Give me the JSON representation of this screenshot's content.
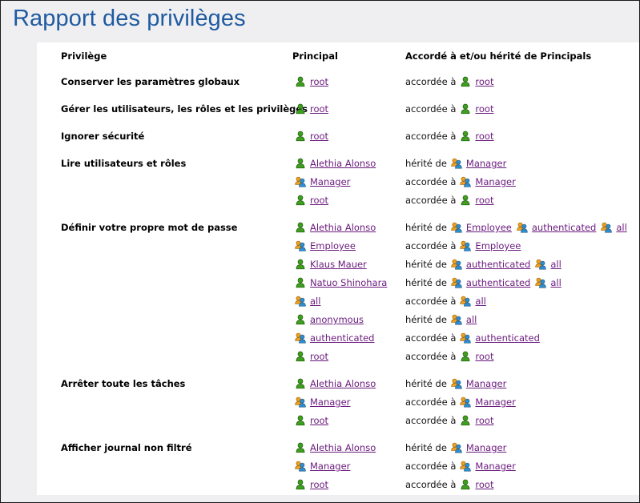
{
  "page": {
    "title": "Rapport des privilèges"
  },
  "colors": {
    "title": "#1f5aa0",
    "link": "#6a1b7d",
    "user_icon": "#3ea01e",
    "group_icon_front": "#2e8fd0",
    "group_icon_back": "#f0a020"
  },
  "table": {
    "headers": [
      "Privilège",
      "Principal",
      "Accordé à et/ou hérité de Principals"
    ],
    "rows": [
      {
        "privilege": "Conserver les paramètres globaux",
        "entries": [
          {
            "principal": {
              "name": "root",
              "icon": "user-icon"
            },
            "verb": "accordée à",
            "sources": [
              {
                "name": "root",
                "icon": "user-icon"
              }
            ]
          }
        ]
      },
      {
        "privilege": "Gérer les utilisateurs, les rôles et les privilèges",
        "entries": [
          {
            "principal": {
              "name": "root",
              "icon": "user-icon"
            },
            "verb": "accordée à",
            "sources": [
              {
                "name": "root",
                "icon": "user-icon"
              }
            ]
          }
        ]
      },
      {
        "privilege": "Ignorer sécurité",
        "entries": [
          {
            "principal": {
              "name": "root",
              "icon": "user-icon"
            },
            "verb": "accordée à",
            "sources": [
              {
                "name": "root",
                "icon": "user-icon"
              }
            ]
          }
        ]
      },
      {
        "privilege": "Lire utilisateurs et rôles",
        "entries": [
          {
            "principal": {
              "name": "Alethia Alonso",
              "icon": "user-icon"
            },
            "verb": "hérité de",
            "sources": [
              {
                "name": "Manager",
                "icon": "group-icon"
              }
            ]
          },
          {
            "principal": {
              "name": "Manager",
              "icon": "group-icon"
            },
            "verb": "accordée à",
            "sources": [
              {
                "name": "Manager",
                "icon": "group-icon"
              }
            ]
          },
          {
            "principal": {
              "name": "root",
              "icon": "user-icon"
            },
            "verb": "accordée à",
            "sources": [
              {
                "name": "root",
                "icon": "user-icon"
              }
            ]
          }
        ]
      },
      {
        "privilege": "Définir votre propre mot de passe",
        "entries": [
          {
            "principal": {
              "name": "Alethia Alonso",
              "icon": "user-icon"
            },
            "verb": "hérité de",
            "sources": [
              {
                "name": "Employee",
                "icon": "group-icon"
              },
              {
                "name": "authenticated",
                "icon": "group-icon"
              },
              {
                "name": "all",
                "icon": "group-icon"
              }
            ]
          },
          {
            "principal": {
              "name": "Employee",
              "icon": "group-icon"
            },
            "verb": "accordée à",
            "sources": [
              {
                "name": "Employee",
                "icon": "group-icon"
              }
            ]
          },
          {
            "principal": {
              "name": "Klaus Mauer",
              "icon": "user-icon"
            },
            "verb": "hérité de",
            "sources": [
              {
                "name": "authenticated",
                "icon": "group-icon"
              },
              {
                "name": "all",
                "icon": "group-icon"
              }
            ]
          },
          {
            "principal": {
              "name": "Natuo Shinohara",
              "icon": "user-icon"
            },
            "verb": "hérité de",
            "sources": [
              {
                "name": "authenticated",
                "icon": "group-icon"
              },
              {
                "name": "all",
                "icon": "group-icon"
              }
            ]
          },
          {
            "principal": {
              "name": "all",
              "icon": "group-icon"
            },
            "verb": "accordée à",
            "sources": [
              {
                "name": "all",
                "icon": "group-icon"
              }
            ]
          },
          {
            "principal": {
              "name": "anonymous",
              "icon": "user-icon"
            },
            "verb": "hérité de",
            "sources": [
              {
                "name": "all",
                "icon": "group-icon"
              }
            ]
          },
          {
            "principal": {
              "name": "authenticated",
              "icon": "group-icon"
            },
            "verb": "accordée à",
            "sources": [
              {
                "name": "authenticated",
                "icon": "group-icon"
              }
            ]
          },
          {
            "principal": {
              "name": "root",
              "icon": "user-icon"
            },
            "verb": "accordée à",
            "sources": [
              {
                "name": "root",
                "icon": "user-icon"
              }
            ]
          }
        ]
      },
      {
        "privilege": "Arrêter toute les tâches",
        "entries": [
          {
            "principal": {
              "name": "Alethia Alonso",
              "icon": "user-icon"
            },
            "verb": "hérité de",
            "sources": [
              {
                "name": "Manager",
                "icon": "group-icon"
              }
            ]
          },
          {
            "principal": {
              "name": "Manager",
              "icon": "group-icon"
            },
            "verb": "accordée à",
            "sources": [
              {
                "name": "Manager",
                "icon": "group-icon"
              }
            ]
          },
          {
            "principal": {
              "name": "root",
              "icon": "user-icon"
            },
            "verb": "accordée à",
            "sources": [
              {
                "name": "root",
                "icon": "user-icon"
              }
            ]
          }
        ]
      },
      {
        "privilege": "Afficher journal non filtré",
        "entries": [
          {
            "principal": {
              "name": "Alethia Alonso",
              "icon": "user-icon"
            },
            "verb": "hérité de",
            "sources": [
              {
                "name": "Manager",
                "icon": "group-icon"
              }
            ]
          },
          {
            "principal": {
              "name": "Manager",
              "icon": "group-icon"
            },
            "verb": "accordée à",
            "sources": [
              {
                "name": "Manager",
                "icon": "group-icon"
              }
            ]
          },
          {
            "principal": {
              "name": "root",
              "icon": "user-icon"
            },
            "verb": "accordée à",
            "sources": [
              {
                "name": "root",
                "icon": "user-icon"
              }
            ]
          }
        ]
      }
    ]
  }
}
